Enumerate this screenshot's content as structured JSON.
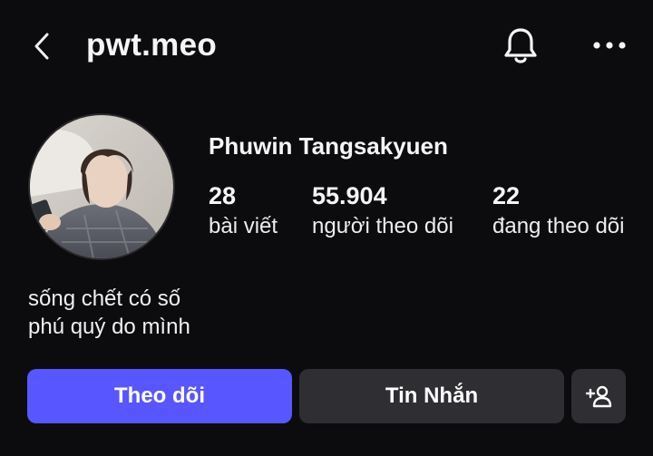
{
  "header": {
    "username": "pwt.meo",
    "icons": {
      "back": "back-chevron-icon",
      "notifications": "bell-icon",
      "more": "more-dots-icon"
    }
  },
  "profile": {
    "full_name": "Phuwin Tangsakyuen",
    "stats": {
      "posts": {
        "value": "28",
        "label": "bài viết"
      },
      "followers": {
        "value": "55.904",
        "label": "người theo dõi"
      },
      "following": {
        "value": "22",
        "label": "đang theo dõi"
      }
    },
    "bio": [
      "sống chết có số",
      "phú quý do mình"
    ]
  },
  "actions": {
    "follow_label": "Theo dõi",
    "message_label": "Tin Nhắn",
    "suggest_icon": "add-person-icon"
  },
  "colors": {
    "background": "#0c0c0f",
    "follow_button": "#5856ff",
    "secondary_button": "#2e2e33",
    "text": "#f5f5f5"
  }
}
